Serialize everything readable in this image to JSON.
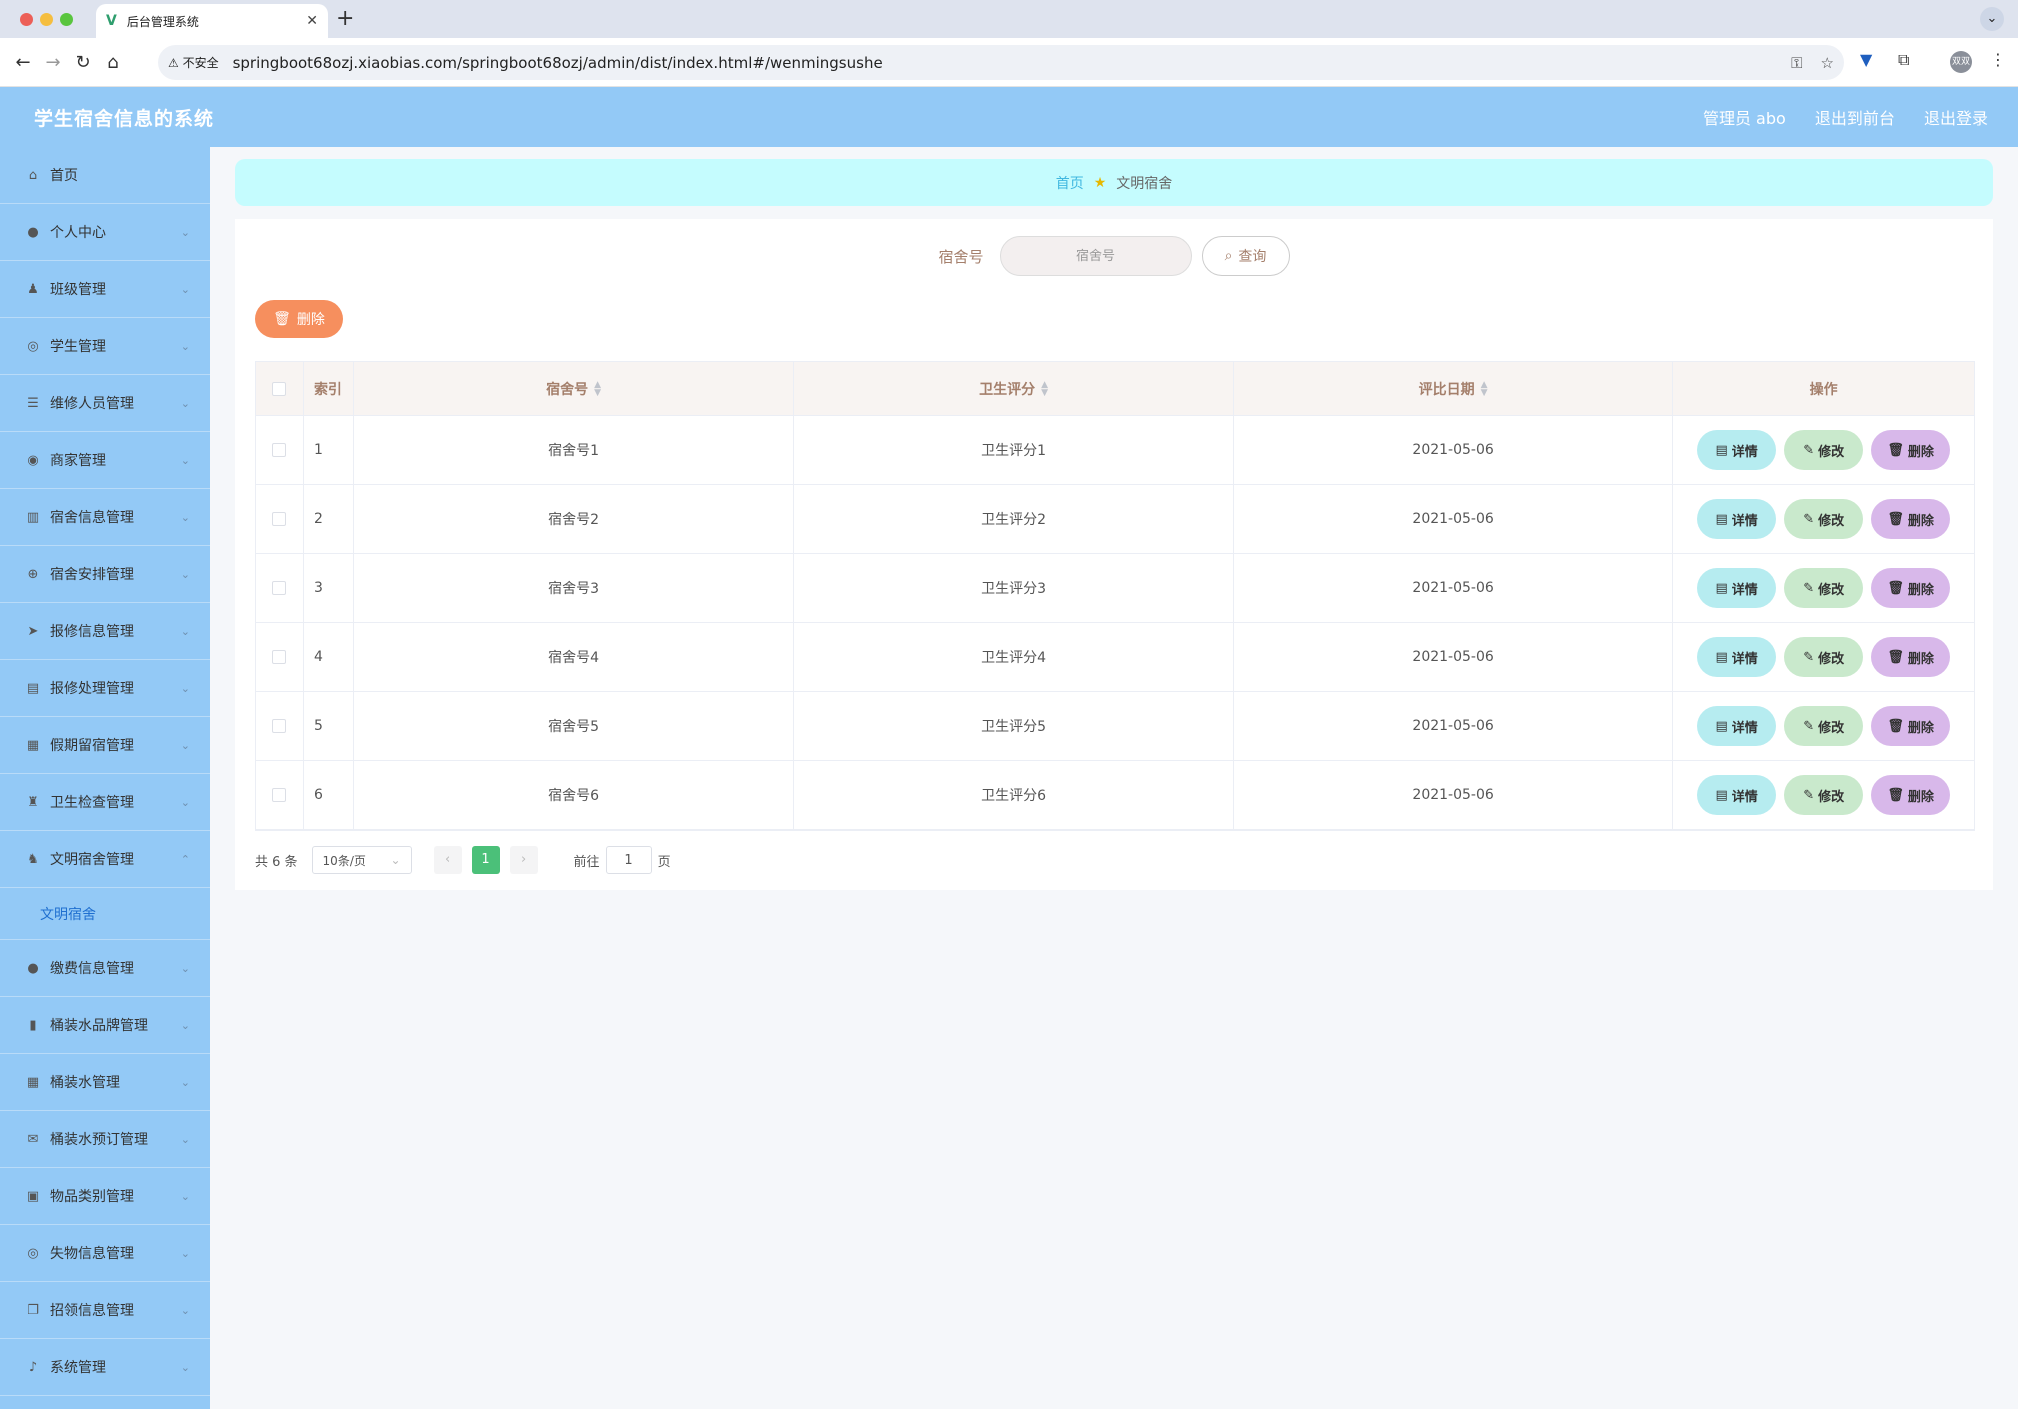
{
  "browser": {
    "tab_title": "后台管理系统",
    "security": "不安全",
    "url": "springboot68ozj.xiaobias.com/springboot68ozj/admin/dist/index.html#/wenmingsushe",
    "profile_label": "双双"
  },
  "header": {
    "brand": "学生宿舍信息的系统",
    "user": "管理员 abo",
    "to_front": "退出到前台",
    "logout": "退出登录"
  },
  "sidebar": {
    "items": [
      {
        "label": "首页",
        "icon": "home-icon"
      },
      {
        "label": "个人中心",
        "icon": "user-icon"
      },
      {
        "label": "班级管理",
        "icon": "person-icon"
      },
      {
        "label": "学生管理",
        "icon": "compass-icon"
      },
      {
        "label": "维修人员管理",
        "icon": "sliders-icon"
      },
      {
        "label": "商家管理",
        "icon": "shop-icon"
      },
      {
        "label": "宿舍信息管理",
        "icon": "chart-icon"
      },
      {
        "label": "宿舍安排管理",
        "icon": "target-icon"
      },
      {
        "label": "报修信息管理",
        "icon": "send-icon"
      },
      {
        "label": "报修处理管理",
        "icon": "clipboard-icon"
      },
      {
        "label": "假期留宿管理",
        "icon": "grid-icon"
      },
      {
        "label": "卫生检查管理",
        "icon": "brush-icon"
      },
      {
        "label": "文明宿舍管理",
        "icon": "medal-icon"
      }
    ],
    "sub_item": "文明宿舍",
    "items_after": [
      {
        "label": "缴费信息管理",
        "icon": "user-icon"
      },
      {
        "label": "桶装水品牌管理",
        "icon": "bar-chart-icon"
      },
      {
        "label": "桶装水管理",
        "icon": "grid-icon"
      },
      {
        "label": "桶装水预订管理",
        "icon": "mail-icon"
      },
      {
        "label": "物品类别管理",
        "icon": "box-icon"
      },
      {
        "label": "失物信息管理",
        "icon": "compass-icon"
      },
      {
        "label": "招领信息管理",
        "icon": "copy-icon"
      },
      {
        "label": "系统管理",
        "icon": "mic-icon"
      }
    ]
  },
  "breadcrumb": {
    "home": "首页",
    "current": "文明宿舍"
  },
  "search": {
    "label": "宿舍号",
    "placeholder": "宿舍号",
    "button": "查询"
  },
  "bulk_delete": "删除",
  "table": {
    "headers": [
      "索引",
      "宿舍号",
      "卫生评分",
      "评比日期",
      "操作"
    ],
    "rows": [
      {
        "idx": "1",
        "no": "宿舍号1",
        "score": "卫生评分1",
        "date": "2021-05-06"
      },
      {
        "idx": "2",
        "no": "宿舍号2",
        "score": "卫生评分2",
        "date": "2021-05-06"
      },
      {
        "idx": "3",
        "no": "宿舍号3",
        "score": "卫生评分3",
        "date": "2021-05-06"
      },
      {
        "idx": "4",
        "no": "宿舍号4",
        "score": "卫生评分4",
        "date": "2021-05-06"
      },
      {
        "idx": "5",
        "no": "宿舍号5",
        "score": "卫生评分5",
        "date": "2021-05-06"
      },
      {
        "idx": "6",
        "no": "宿舍号6",
        "score": "卫生评分6",
        "date": "2021-05-06"
      }
    ],
    "op_detail": "详情",
    "op_edit": "修改",
    "op_delete": "删除"
  },
  "pager": {
    "total": "共 6 条",
    "page_size": "10条/页",
    "current_page": "1",
    "goto_label": "前往",
    "goto_value": "1",
    "page_unit": "页"
  },
  "colors": {
    "header": "#93c9f6",
    "breadcrumb": "#c5fcfe",
    "accent": "#a47f6b",
    "danger": "#f68f5e"
  }
}
